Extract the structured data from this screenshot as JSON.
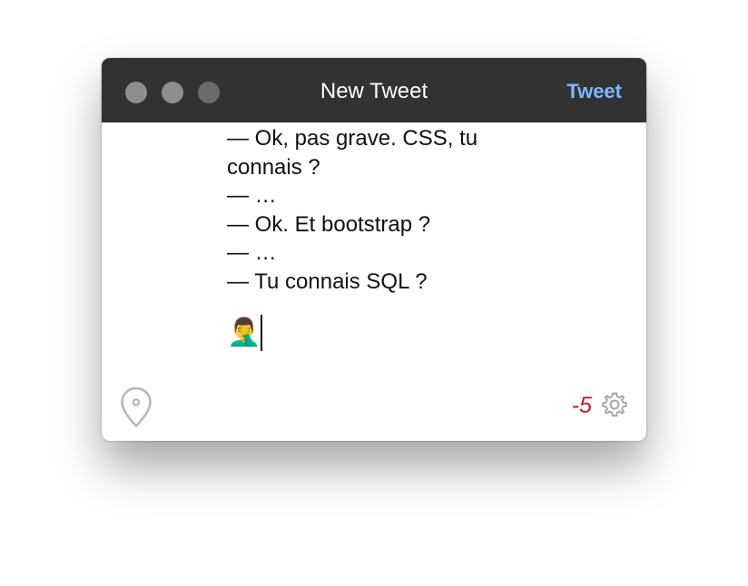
{
  "window": {
    "title": "New Tweet",
    "tweet_button": "Tweet"
  },
  "composer": {
    "lines": [
      "— Ok, pas grave. CSS, tu",
      "connais ?",
      "— …",
      "— Ok. Et bootstrap ?",
      "— …",
      "— Tu connais SQL ?"
    ],
    "emoji": "🤦‍♂️"
  },
  "footer": {
    "char_count": "-5",
    "location_icon": "location-pin-icon",
    "settings_icon": "gear-icon"
  },
  "colors": {
    "titlebar": "#323232",
    "tweet_button": "#7fb8ff",
    "counter": "#c8182a"
  }
}
